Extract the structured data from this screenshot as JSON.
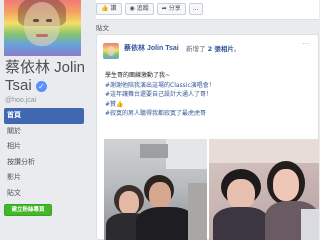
{
  "page": {
    "name": "蔡依林 Jolin Tsai",
    "verified_icon": "verified-check-icon",
    "handle": "@hoo.jcai"
  },
  "nav": {
    "items": [
      {
        "label": "首頁",
        "active": true
      },
      {
        "label": "關於",
        "active": false
      },
      {
        "label": "相片",
        "active": false
      },
      {
        "label": "按讚分析",
        "active": false
      },
      {
        "label": "影片",
        "active": false
      },
      {
        "label": "貼文",
        "active": false
      }
    ]
  },
  "create_page_button": "建立粉絲專頁",
  "actions": {
    "like": "讚",
    "like_icon": "thumbs-up-icon",
    "follow": "追蹤",
    "follow_icon": "rss-icon",
    "share": "分享",
    "share_icon": "share-arrow-icon",
    "more": "..."
  },
  "posts_header": "貼文",
  "post": {
    "author": "蔡依林 Jolin Tsai",
    "action_prefix": "新增了",
    "action_count": "2 張相片",
    "action_suffix": "。",
    "time": "",
    "lines": [
      "學生哥的團練激動了我~",
      "#謝謝他陪我演出這場的Classic演唱會！",
      "#這年讓舞台還要自己設計大通人了哥！",
      "#贊👍",
      "#寂寞的男人聽得我都寂寞了最虎虎哥"
    ]
  },
  "colors": {
    "brand_blue": "#4267b2",
    "link_blue": "#365899",
    "create_green": "#42b72a",
    "background": "#e9ebee"
  }
}
